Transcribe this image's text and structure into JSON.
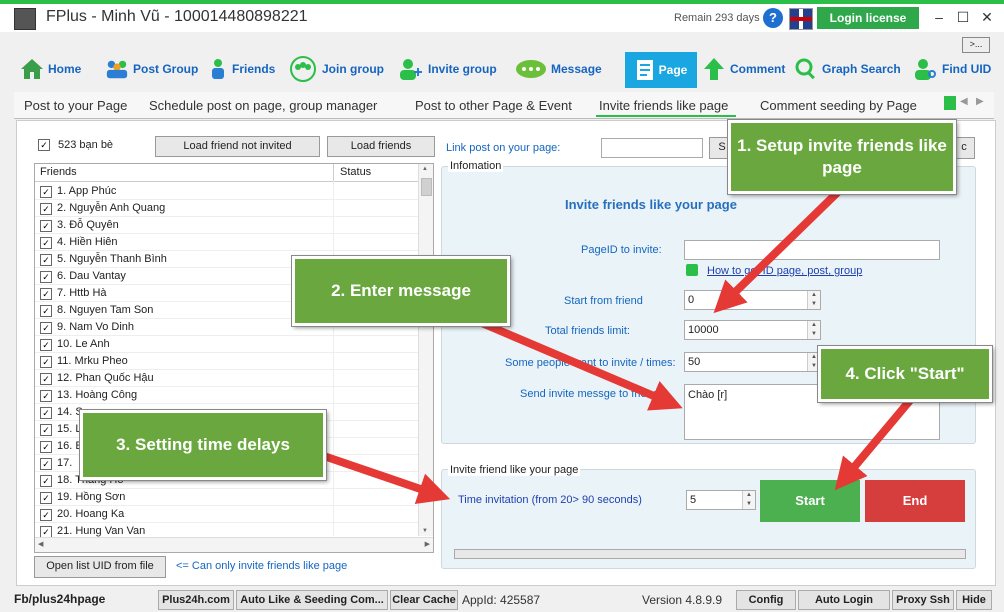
{
  "app": {
    "title": "FPlus - Minh Vũ - 100014480898221",
    "remain": "Remain 293 days",
    "help": "?",
    "login_license": "Login license",
    "more": ">..."
  },
  "nav": [
    {
      "label": "Home",
      "icon": "home-icon"
    },
    {
      "label": "Post Group",
      "icon": "group-icon"
    },
    {
      "label": "Friends",
      "icon": "friends-icon"
    },
    {
      "label": "Join group",
      "icon": "join-group-icon"
    },
    {
      "label": "Invite group",
      "icon": "add-user-icon"
    },
    {
      "label": "Message",
      "icon": "chat-icon"
    },
    {
      "label": "Page",
      "icon": "page-icon"
    },
    {
      "label": "Comment",
      "icon": "arrow-up-icon"
    },
    {
      "label": "Graph Search",
      "icon": "search-icon"
    },
    {
      "label": "Find UID",
      "icon": "find-user-icon"
    }
  ],
  "subtabs": [
    "Post to your Page",
    "Schedule post on page, group manager",
    "Post to other Page & Event",
    "Invite friends like page",
    "Comment seeding by Page"
  ],
  "left": {
    "friend_count": "523 bạn bè",
    "load_not_invited": "Load friend not invited",
    "load_friends": "Load friends",
    "col_friends": "Friends",
    "col_status": "Status",
    "friends": [
      "1. App Phúc",
      "2. Nguyễn Anh Quang",
      "3. Đỗ Quyên",
      "4. Hiền Hiên",
      "5. Nguyễn Thanh Bình",
      "6. Dau Vantay",
      "7. Httb Hà",
      "8. Nguyen Tam Son",
      "9. Nam Vo Dinh",
      "10. Le Anh",
      "11. Mrku Pheo",
      "12. Phan Quốc Hậu",
      "13. Hoàng Công",
      "14. S",
      "15. L",
      "16. E",
      "17.",
      "18. Thang Ho",
      "19. Hồng Sơn",
      "20. Hoang Ka",
      "21. Hung Van Van"
    ],
    "open_list": "Open list UID from file",
    "note": "<= Can only invite friends like page"
  },
  "right": {
    "link_post_label": "Link post on your page:",
    "s_btn": "S",
    "c_btn": "c",
    "info_title": "Infomation",
    "heading": "Invite friends like your page",
    "pageid_label": "PageID to invite:",
    "pageid_value": "",
    "howto": "How to get ID page, post, group",
    "start_from_label": "Start from friend",
    "start_from_value": "0",
    "total_limit_label": "Total friends limit:",
    "total_limit_value": "10000",
    "some_people_label": "Some people want to invite / times:",
    "some_people_value": "50",
    "send_msg_label": "Send invite messge to friend:",
    "send_msg_value": "Chào [r]",
    "group2_title": "Invite friend like your page",
    "time_label": "Time invitation (from 20> 90 seconds)",
    "time_value": "5",
    "start": "Start",
    "end": "End"
  },
  "status": {
    "fb": "Fb/plus24hpage",
    "plus24h": "Plus24h.com",
    "auto_like": "Auto Like & Seeding Com...",
    "clear_cache": "Clear Cache",
    "appid": "AppId: 425587",
    "version": "Version 4.8.9.9",
    "config": "Config",
    "auto_login": "Auto Login",
    "proxy": "Proxy Ssh",
    "hide": "Hide"
  },
  "callouts": {
    "c1": "1. Setup invite friends like page",
    "c2": "2. Enter message",
    "c3": "3. Setting time delays",
    "c4": "4. Click \"Start\""
  },
  "colors": {
    "accent": "#2bbf4a",
    "nav_text": "#1565c0",
    "page_tab": "#1aa6e0",
    "start": "#4caf50",
    "end": "#d63d3d",
    "callout": "#6aa83f",
    "arrow": "#e53935"
  }
}
